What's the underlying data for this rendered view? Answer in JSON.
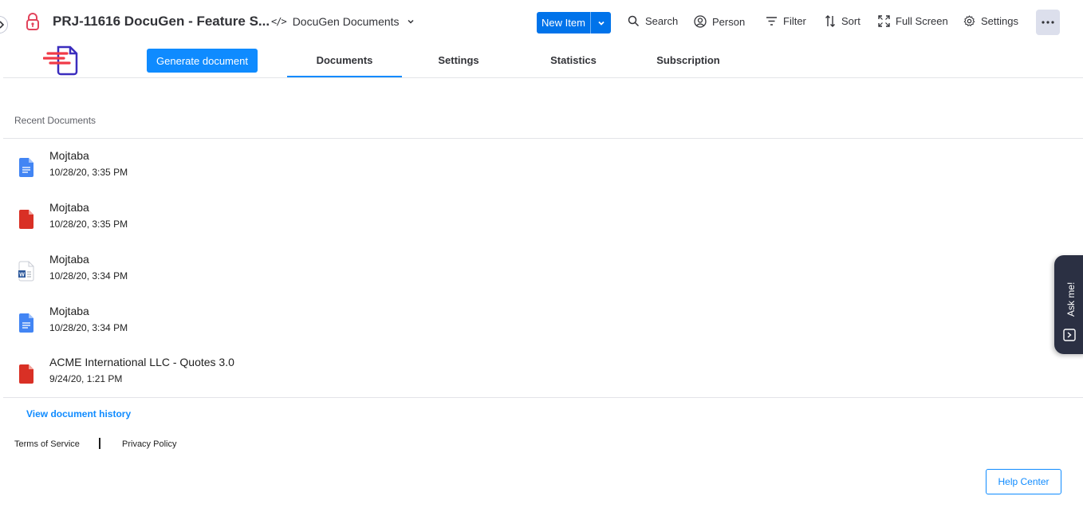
{
  "header": {
    "board_title": "PRJ-11616 DocuGen - Feature S...",
    "view_name": "DocuGen Documents",
    "new_item_label": "New Item",
    "tools": {
      "search": "Search",
      "person": "Person",
      "filter": "Filter",
      "sort": "Sort",
      "full_screen": "Full Screen",
      "settings": "Settings"
    }
  },
  "app": {
    "generate_button": "Generate document",
    "tabs": [
      "Documents",
      "Settings",
      "Statistics",
      "Subscription"
    ],
    "active_tab": "Documents"
  },
  "documents": {
    "section_title": "Recent Documents",
    "items": [
      {
        "name": "Mojtaba",
        "date": "10/28/20, 3:35 PM",
        "icon": "google-doc-icon"
      },
      {
        "name": "Mojtaba",
        "date": "10/28/20, 3:35 PM",
        "icon": "pdf-icon"
      },
      {
        "name": "Mojtaba",
        "date": "10/28/20, 3:34 PM",
        "icon": "word-doc-icon"
      },
      {
        "name": "Mojtaba",
        "date": "10/28/20, 3:34 PM",
        "icon": "google-doc-icon"
      },
      {
        "name": "ACME International LLC - Quotes 3.0",
        "date": "9/24/20, 1:21 PM",
        "icon": "pdf-icon"
      }
    ],
    "history_link": "View document history"
  },
  "footer": {
    "terms": "Terms of Service",
    "privacy": "Privacy Policy",
    "help_center": "Help Center"
  },
  "ask_me": {
    "label": "Ask me!"
  },
  "colors": {
    "primary": "#0073ea",
    "accent": "#0f8bff",
    "pdf_red": "#d93025",
    "gdoc_blue": "#4285f4",
    "ask_bg": "#2b3043"
  }
}
